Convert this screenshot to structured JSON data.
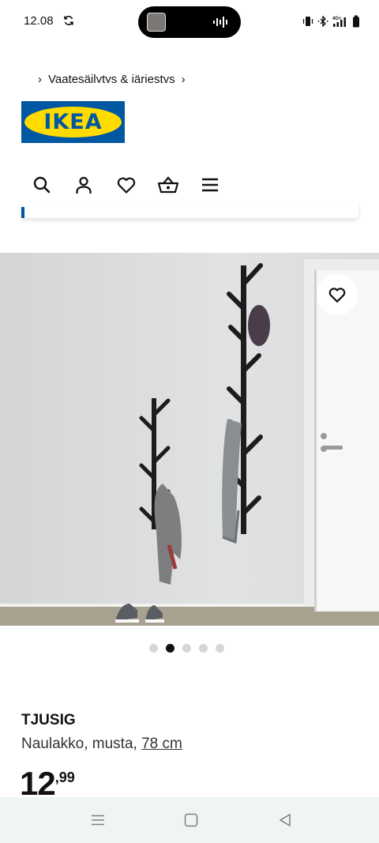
{
  "status_bar": {
    "time": "12.08",
    "network": "4G+"
  },
  "breadcrumb": {
    "item": "Vaatesäilytys & järjestys"
  },
  "logo": {
    "text": "IKEA",
    "brand_blue": "#0058a3",
    "brand_yellow": "#ffdb00"
  },
  "header": {
    "icons": [
      "search-icon",
      "account-icon",
      "heart-icon",
      "basket-icon",
      "menu-icon"
    ]
  },
  "product_image": {
    "carousel_total": 5,
    "carousel_active_index": 1
  },
  "product": {
    "name": "TJUSIG",
    "description": "Naulakko, musta,",
    "size_link": "78 cm",
    "price_int": "12",
    "price_dec": ",99"
  },
  "navbar": {
    "buttons": [
      "recent-apps",
      "home",
      "back"
    ]
  }
}
